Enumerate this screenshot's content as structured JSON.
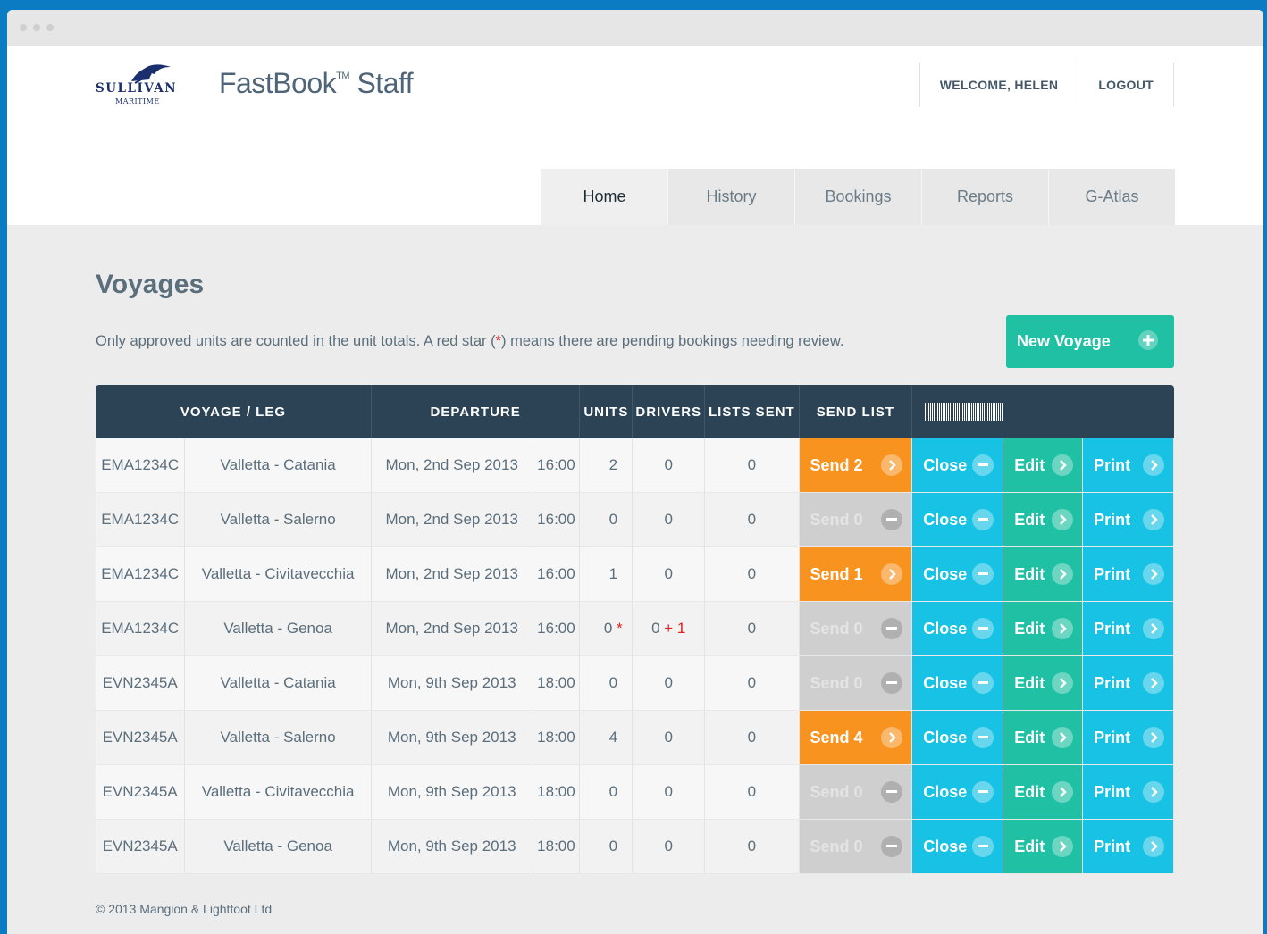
{
  "brand": {
    "logo_text": "SULLIVAN",
    "logo_sub": "MARITIME",
    "app_name": "FastBook",
    "tm": "TM",
    "app_suffix": "Staff"
  },
  "topnav": {
    "welcome": "WELCOME, HELEN",
    "logout": "LOGOUT"
  },
  "tabs": [
    "Home",
    "History",
    "Bookings",
    "Reports",
    "G-Atlas"
  ],
  "active_tab": "Home",
  "page": {
    "title": "Voyages",
    "info_pre": "Only approved units are counted in the unit totals. A red star (",
    "info_star": "*",
    "info_post": ") means there are pending bookings needing review.",
    "new_voyage": "New Voyage"
  },
  "table": {
    "headers": [
      "VOYAGE / LEG",
      "DEPARTURE",
      "UNITS",
      "DRIVERS",
      "LISTS SENT",
      "SEND LIST"
    ],
    "rows": [
      {
        "code": "EMA1234C",
        "leg": "Valletta - Catania",
        "date": "Mon, 2nd Sep 2013",
        "time": "16:00",
        "units": "2",
        "units_star": "",
        "drivers": "0",
        "drivers_extra": "",
        "lists": "0",
        "send": "Send 2",
        "send_enabled": true
      },
      {
        "code": "EMA1234C",
        "leg": "Valletta - Salerno",
        "date": "Mon, 2nd Sep 2013",
        "time": "16:00",
        "units": "0",
        "units_star": "",
        "drivers": "0",
        "drivers_extra": "",
        "lists": "0",
        "send": "Send 0",
        "send_enabled": false
      },
      {
        "code": "EMA1234C",
        "leg": "Valletta - Civitavecchia",
        "date": "Mon, 2nd Sep 2013",
        "time": "16:00",
        "units": "1",
        "units_star": "",
        "drivers": "0",
        "drivers_extra": "",
        "lists": "0",
        "send": "Send 1",
        "send_enabled": true
      },
      {
        "code": "EMA1234C",
        "leg": "Valletta - Genoa",
        "date": "Mon, 2nd Sep 2013",
        "time": "16:00",
        "units": "0",
        "units_star": "*",
        "drivers": "0",
        "drivers_extra": "+ 1",
        "lists": "0",
        "send": "Send 0",
        "send_enabled": false
      },
      {
        "code": "EVN2345A",
        "leg": "Valletta - Catania",
        "date": "Mon, 9th Sep 2013",
        "time": "18:00",
        "units": "0",
        "units_star": "",
        "drivers": "0",
        "drivers_extra": "",
        "lists": "0",
        "send": "Send 0",
        "send_enabled": false
      },
      {
        "code": "EVN2345A",
        "leg": "Valletta - Salerno",
        "date": "Mon, 9th Sep 2013",
        "time": "18:00",
        "units": "4",
        "units_star": "",
        "drivers": "0",
        "drivers_extra": "",
        "lists": "0",
        "send": "Send 4",
        "send_enabled": true
      },
      {
        "code": "EVN2345A",
        "leg": "Valletta - Civitavecchia",
        "date": "Mon, 9th Sep 2013",
        "time": "18:00",
        "units": "0",
        "units_star": "",
        "drivers": "0",
        "drivers_extra": "",
        "lists": "0",
        "send": "Send 0",
        "send_enabled": false
      },
      {
        "code": "EVN2345A",
        "leg": "Valletta - Genoa",
        "date": "Mon, 9th Sep 2013",
        "time": "18:00",
        "units": "0",
        "units_star": "",
        "drivers": "0",
        "drivers_extra": "",
        "lists": "0",
        "send": "Send 0",
        "send_enabled": false
      }
    ],
    "action_labels": {
      "close": "Close",
      "edit": "Edit",
      "print": "Print"
    }
  },
  "footer": "© 2013 Mangion & Lightfoot Ltd",
  "colors": {
    "frame_blue": "#0b7cc4",
    "header_dark": "#2c4356",
    "send_orange": "#f7931e",
    "send_disabled": "#cfcfcf",
    "close_cyan": "#18c2e4",
    "edit_teal": "#1fc0a4",
    "star_red": "#e02020"
  },
  "icons": {
    "send": "chevron-right-icon",
    "send_disabled": "minus-icon",
    "close": "minus-icon",
    "edit": "chevron-right-icon",
    "print": "chevron-right-icon",
    "new_voyage": "plus-icon",
    "header_extra": "barcode-icon"
  }
}
